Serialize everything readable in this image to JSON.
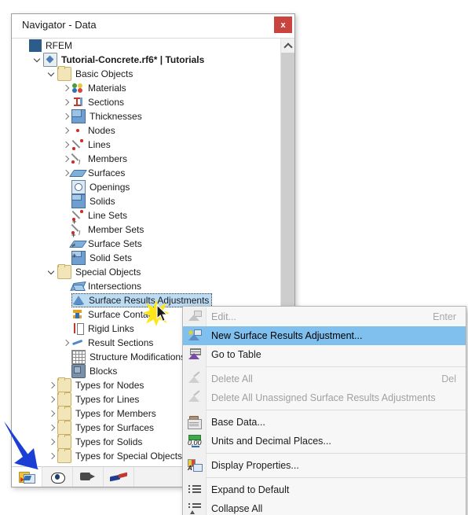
{
  "window": {
    "title": "Navigator - Data",
    "close_label": "x"
  },
  "tree": {
    "items": [
      {
        "label": "RFEM",
        "indent": 0,
        "chev": "none",
        "icon": "rfem-icon",
        "bold": false,
        "selected": false
      },
      {
        "label": "Tutorial-Concrete.rf6* | Tutorials",
        "indent": 1,
        "chev": "down",
        "icon": "file-icon",
        "bold": true,
        "selected": false
      },
      {
        "label": "Basic Objects",
        "indent": 2,
        "chev": "down",
        "icon": "folder-icon",
        "bold": false,
        "selected": false
      },
      {
        "label": "Materials",
        "indent": 3,
        "chev": "right",
        "icon": "materials-icon",
        "bold": false,
        "selected": false
      },
      {
        "label": "Sections",
        "indent": 3,
        "chev": "right",
        "icon": "sections-icon",
        "bold": false,
        "selected": false
      },
      {
        "label": "Thicknesses",
        "indent": 3,
        "chev": "right",
        "icon": "thicknesses-icon",
        "bold": false,
        "selected": false
      },
      {
        "label": "Nodes",
        "indent": 3,
        "chev": "right",
        "icon": "nodes-icon",
        "bold": false,
        "selected": false
      },
      {
        "label": "Lines",
        "indent": 3,
        "chev": "right",
        "icon": "lines-icon",
        "bold": false,
        "selected": false
      },
      {
        "label": "Members",
        "indent": 3,
        "chev": "right",
        "icon": "members-icon",
        "bold": false,
        "selected": false
      },
      {
        "label": "Surfaces",
        "indent": 3,
        "chev": "right",
        "icon": "surfaces-icon",
        "bold": false,
        "selected": false
      },
      {
        "label": "Openings",
        "indent": 3,
        "chev": "none",
        "icon": "openings-icon",
        "bold": false,
        "selected": false
      },
      {
        "label": "Solids",
        "indent": 3,
        "chev": "none",
        "icon": "solids-icon",
        "bold": false,
        "selected": false
      },
      {
        "label": "Line Sets",
        "indent": 3,
        "chev": "none",
        "icon": "line-sets-icon",
        "bold": false,
        "selected": false
      },
      {
        "label": "Member Sets",
        "indent": 3,
        "chev": "none",
        "icon": "member-sets-icon",
        "bold": false,
        "selected": false
      },
      {
        "label": "Surface Sets",
        "indent": 3,
        "chev": "none",
        "icon": "surface-sets-icon",
        "bold": false,
        "selected": false
      },
      {
        "label": "Solid Sets",
        "indent": 3,
        "chev": "none",
        "icon": "solid-sets-icon",
        "bold": false,
        "selected": false
      },
      {
        "label": "Special Objects",
        "indent": 2,
        "chev": "down",
        "icon": "folder-icon",
        "bold": false,
        "selected": false
      },
      {
        "label": "Intersections",
        "indent": 3,
        "chev": "none",
        "icon": "intersections-icon",
        "bold": false,
        "selected": false
      },
      {
        "label": "Surface Results Adjustments",
        "indent": 3,
        "chev": "none",
        "icon": "surface-results-adjustments-icon",
        "bold": false,
        "selected": true
      },
      {
        "label": "Surface Contacts",
        "indent": 3,
        "chev": "none",
        "icon": "surface-contacts-icon",
        "bold": false,
        "selected": false
      },
      {
        "label": "Rigid Links",
        "indent": 3,
        "chev": "none",
        "icon": "rigid-links-icon",
        "bold": false,
        "selected": false
      },
      {
        "label": "Result Sections",
        "indent": 3,
        "chev": "right",
        "icon": "result-sections-icon",
        "bold": false,
        "selected": false
      },
      {
        "label": "Structure Modifications",
        "indent": 3,
        "chev": "none",
        "icon": "structure-modifications-icon",
        "bold": false,
        "selected": false
      },
      {
        "label": "Blocks",
        "indent": 3,
        "chev": "none",
        "icon": "blocks-icon",
        "bold": false,
        "selected": false
      },
      {
        "label": "Types for Nodes",
        "indent": 2,
        "chev": "right",
        "icon": "folder-icon",
        "bold": false,
        "selected": false
      },
      {
        "label": "Types for Lines",
        "indent": 2,
        "chev": "right",
        "icon": "folder-icon",
        "bold": false,
        "selected": false
      },
      {
        "label": "Types for Members",
        "indent": 2,
        "chev": "right",
        "icon": "folder-icon",
        "bold": false,
        "selected": false
      },
      {
        "label": "Types for Surfaces",
        "indent": 2,
        "chev": "right",
        "icon": "folder-icon",
        "bold": false,
        "selected": false
      },
      {
        "label": "Types for Solids",
        "indent": 2,
        "chev": "right",
        "icon": "folder-icon",
        "bold": false,
        "selected": false
      },
      {
        "label": "Types for Special Objects",
        "indent": 2,
        "chev": "right",
        "icon": "folder-icon",
        "bold": false,
        "selected": false
      }
    ]
  },
  "toolbar": {
    "buttons": [
      {
        "name": "navigator-data-button",
        "icon": "navigator-data-icon",
        "active": true
      },
      {
        "name": "navigator-display-button",
        "icon": "eye-icon",
        "active": false
      },
      {
        "name": "navigator-views-button",
        "icon": "camera-icon",
        "active": false
      },
      {
        "name": "navigator-results-button",
        "icon": "flag-icon",
        "active": false
      }
    ]
  },
  "context_menu": {
    "items": [
      {
        "label": "Edit...",
        "accel": "Enter",
        "icon": "edit-icon",
        "state": "disabled"
      },
      {
        "label": "New Surface Results Adjustment...",
        "accel": "",
        "icon": "new-surface-results-adjustment-icon",
        "state": "highlighted"
      },
      {
        "label": "Go to Table",
        "accel": "",
        "icon": "go-to-table-icon",
        "state": "enabled"
      },
      {
        "separator": true
      },
      {
        "label": "Delete All",
        "accel": "Del",
        "icon": "delete-all-icon",
        "state": "disabled"
      },
      {
        "label": "Delete All Unassigned Surface Results Adjustments",
        "accel": "",
        "icon": "delete-unassigned-icon",
        "state": "disabled"
      },
      {
        "separator": true
      },
      {
        "label": "Base Data...",
        "accel": "",
        "icon": "base-data-icon",
        "state": "enabled"
      },
      {
        "label": "Units and Decimal Places...",
        "accel": "",
        "icon": "units-icon",
        "state": "enabled"
      },
      {
        "separator": true
      },
      {
        "label": "Display Properties...",
        "accel": "",
        "icon": "display-properties-icon",
        "state": "enabled"
      },
      {
        "separator": true
      },
      {
        "label": "Expand to Default",
        "accel": "",
        "icon": "expand-icon",
        "state": "enabled"
      },
      {
        "label": "Collapse All",
        "accel": "",
        "icon": "collapse-icon",
        "state": "enabled"
      }
    ]
  },
  "annotations": {
    "arrow_color": "#1b3fd4",
    "highlight_color": "#ffe61a",
    "selection_color": "#bcdcf4",
    "menu_highlight_color": "#7fc0ee",
    "close_button_color": "#c9443f"
  }
}
